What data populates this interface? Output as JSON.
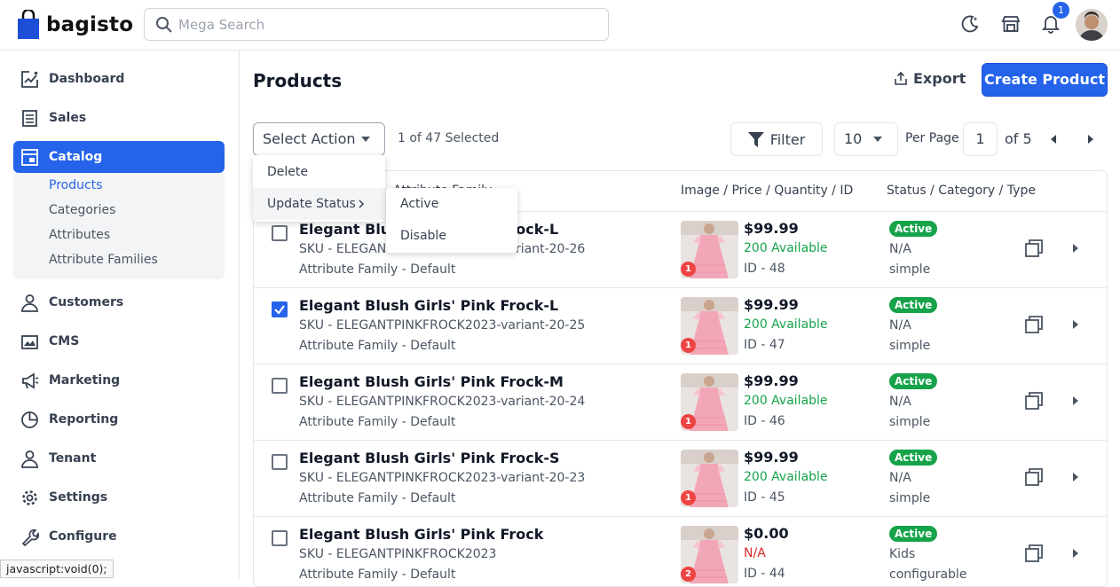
{
  "app": {
    "brand": "bagisto"
  },
  "search": {
    "placeholder": "Mega Search"
  },
  "header": {
    "notifications_count": "1"
  },
  "sidebar": {
    "items": [
      {
        "label": "Dashboard",
        "icon": "dashboard-icon"
      },
      {
        "label": "Sales",
        "icon": "sales-icon"
      },
      {
        "label": "Catalog",
        "icon": "catalog-icon",
        "active": true
      },
      {
        "label": "Customers",
        "icon": "customers-icon"
      },
      {
        "label": "CMS",
        "icon": "cms-icon"
      },
      {
        "label": "Marketing",
        "icon": "marketing-icon"
      },
      {
        "label": "Reporting",
        "icon": "reporting-icon"
      },
      {
        "label": "Tenant",
        "icon": "tenant-icon"
      },
      {
        "label": "Settings",
        "icon": "settings-icon"
      },
      {
        "label": "Configure",
        "icon": "configure-icon"
      }
    ],
    "catalog_sub": [
      "Products",
      "Categories",
      "Attributes",
      "Attribute Families"
    ]
  },
  "page": {
    "title": "Products",
    "export_label": "Export",
    "create_label": "Create Product"
  },
  "toolbar": {
    "select_action": "Select Action",
    "selected_count": "1 of 47 Selected",
    "filter_label": "Filter",
    "per_page_value": "10",
    "per_page_label": "Per Page",
    "page_value": "1",
    "page_of": "of 5"
  },
  "dropdown": {
    "delete": "Delete",
    "update_status": "Update Status",
    "submenu": [
      "Active",
      "Disable"
    ]
  },
  "table": {
    "headers": {
      "col1_tail": "Attribute Family",
      "col2": "Image / Price / Quantity / ID",
      "col3": "Status / Category / Type"
    },
    "rows": [
      {
        "name": "Elegant Blush Girls' Pink Frock-L",
        "sku": "SKU - ELEGANTPINKFROCK2023-variant-20-26",
        "family": "Attribute Family - Default",
        "price": "$99.99",
        "qty": "200 Available",
        "id": "ID - 48",
        "status": "Active",
        "category": "N/A",
        "type": "simple",
        "images": "1",
        "checked": false
      },
      {
        "name": "Elegant Blush Girls' Pink Frock-L",
        "sku": "SKU - ELEGANTPINKFROCK2023-variant-20-25",
        "family": "Attribute Family - Default",
        "price": "$99.99",
        "qty": "200 Available",
        "id": "ID - 47",
        "status": "Active",
        "category": "N/A",
        "type": "simple",
        "images": "1",
        "checked": true
      },
      {
        "name": "Elegant Blush Girls' Pink Frock-M",
        "sku": "SKU - ELEGANTPINKFROCK2023-variant-20-24",
        "family": "Attribute Family - Default",
        "price": "$99.99",
        "qty": "200 Available",
        "id": "ID - 46",
        "status": "Active",
        "category": "N/A",
        "type": "simple",
        "images": "1",
        "checked": false
      },
      {
        "name": "Elegant Blush Girls' Pink Frock-S",
        "sku": "SKU - ELEGANTPINKFROCK2023-variant-20-23",
        "family": "Attribute Family - Default",
        "price": "$99.99",
        "qty": "200 Available",
        "id": "ID - 45",
        "status": "Active",
        "category": "N/A",
        "type": "simple",
        "images": "1",
        "checked": false
      },
      {
        "name": "Elegant Blush Girls' Pink Frock",
        "sku": "SKU - ELEGANTPINKFROCK2023",
        "family": "Attribute Family - Default",
        "price": "$0.00",
        "qty": "N/A",
        "id": "ID - 44",
        "status": "Active",
        "category": "Kids",
        "type": "configurable",
        "images": "2",
        "checked": false
      }
    ]
  },
  "statusbar": {
    "text": "javascript:void(0);"
  },
  "colors": {
    "accent": "#2563eb",
    "active_badge": "#16a34a",
    "image_count_badge": "#ef4444"
  }
}
